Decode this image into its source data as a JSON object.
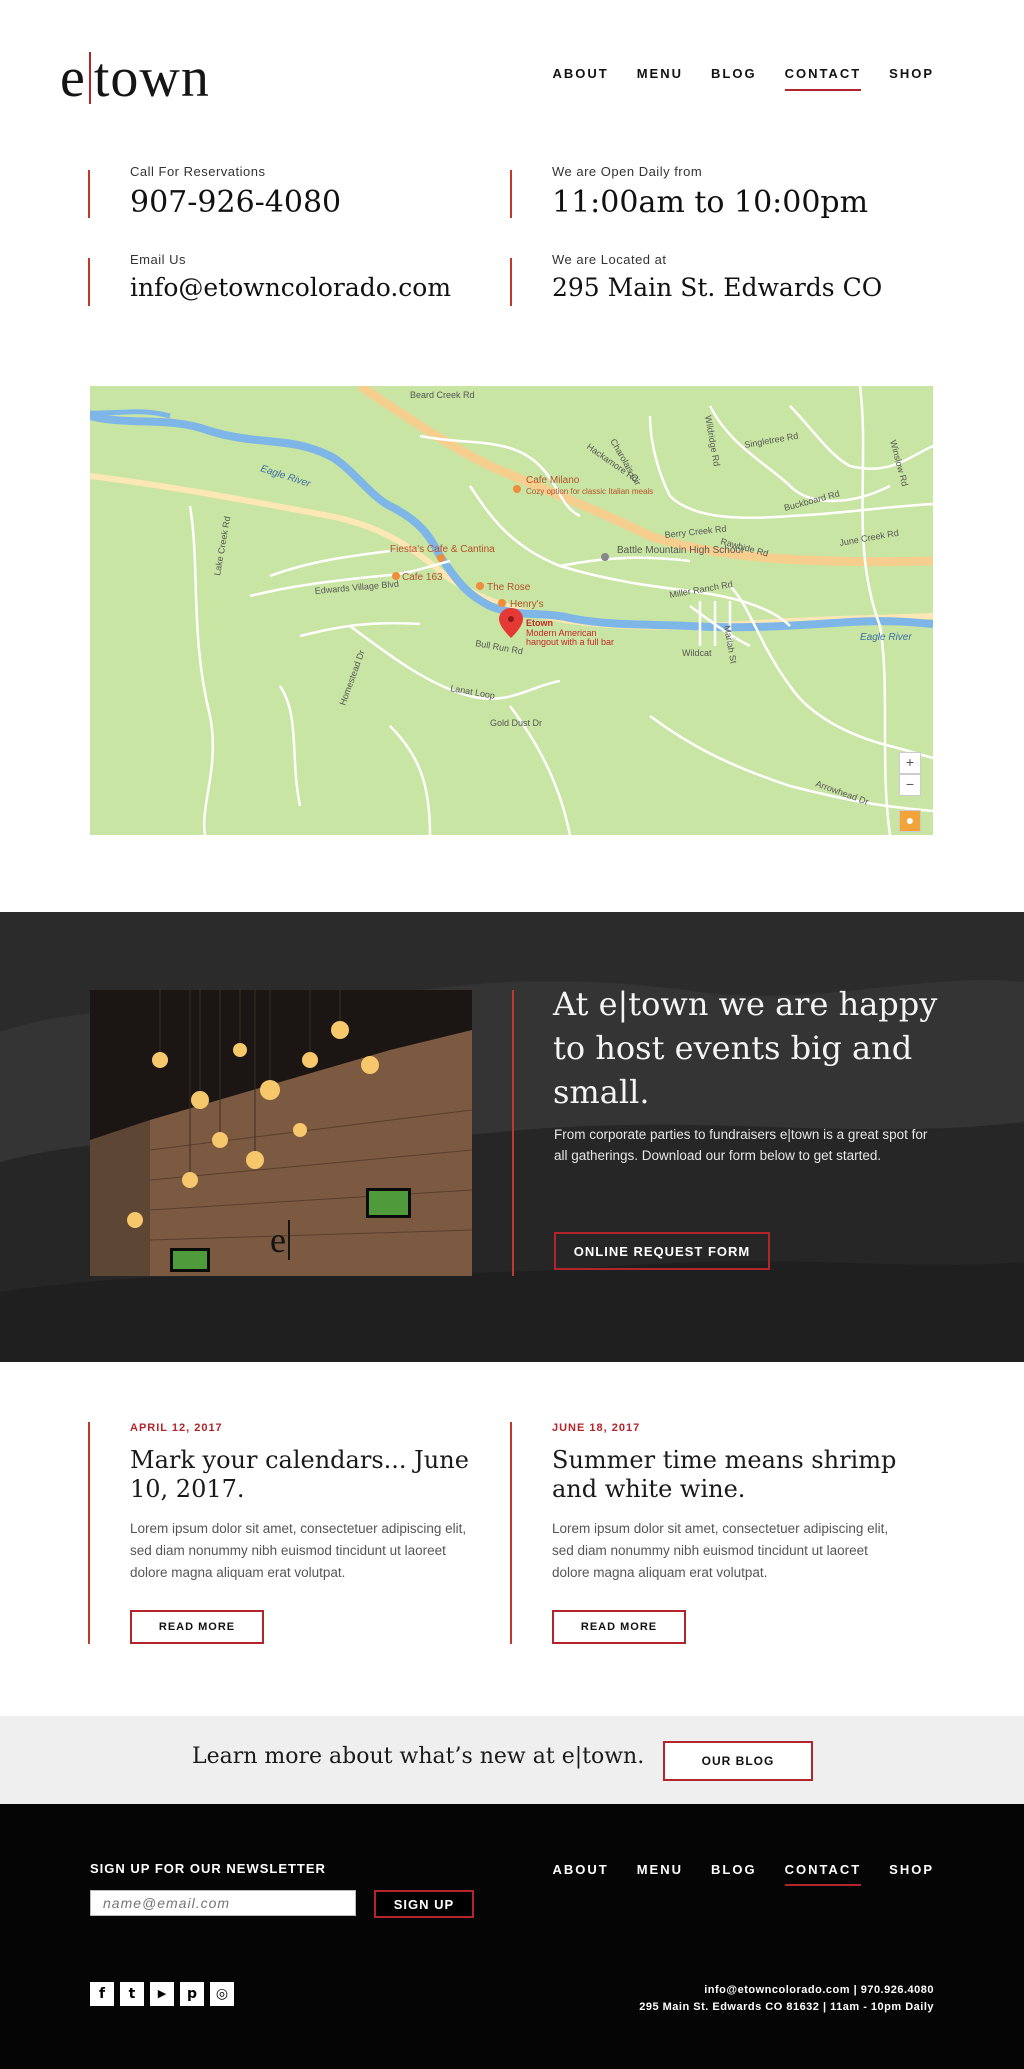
{
  "brand": {
    "logo_left": "e",
    "logo_right": "town"
  },
  "nav": {
    "items": [
      "ABOUT",
      "MENU",
      "BLOG",
      "CONTACT",
      "SHOP"
    ],
    "active": "CONTACT"
  },
  "contact": {
    "reservations_label": "Call For Reservations",
    "reservations_value": "907-926-4080",
    "hours_label": "We are Open Daily from",
    "hours_value": "11:00am to 10:00pm",
    "email_label": "Email Us",
    "email_value": "info@etowncolorado.com",
    "location_label": "We are Located at",
    "location_value": "295 Main St. Edwards CO"
  },
  "map": {
    "roads": [
      "Beard Creek Rd",
      "Hackamore Rd",
      "Charolais Cir",
      "Wildridge Rd",
      "Singletree Rd",
      "Winslow Rd",
      "Berry Creek Rd",
      "Rawhide Rd",
      "Buckboard Rd",
      "June Creek Rd",
      "Miller Ranch Rd",
      "Lake Creek Rd",
      "Edwards Village Blvd",
      "Homestead Dr",
      "Bull Run Rd",
      "Gold Dust Dr",
      "Lanat Loop",
      "Arrowhead Dr",
      "Wildcat",
      "Mariah St"
    ],
    "water": [
      "Eagle River"
    ],
    "places": [
      {
        "name": "Cafe Milano",
        "sub": "Cozy option for classic Italian meals"
      },
      {
        "name": "Fiesta's Cafe & Cantina",
        "sub": ""
      },
      {
        "name": "Cafe 163",
        "sub": ""
      },
      {
        "name": "The Rose",
        "sub": ""
      },
      {
        "name": "Henry's",
        "sub": ""
      },
      {
        "name": "Battle Mountain High School",
        "sub": ""
      }
    ],
    "marker": {
      "name": "Etown",
      "sub1": "Modern American",
      "sub2": "hangout with a full bar"
    },
    "zoom_in": "+",
    "zoom_out": "−"
  },
  "events": {
    "heading": "At e|town we are happy to host events big and small.",
    "body": "From corporate parties to fundraisers e|town is a great spot for all gatherings. Download our form below to get started.",
    "button": "ONLINE REQUEST FORM"
  },
  "news": [
    {
      "date": "APRIL 12, 2017",
      "title": "Mark your calendars... June 10, 2017.",
      "body": "Lorem ipsum dolor sit amet, consectetuer adipiscing elit, sed diam nonummy nibh euismod tincidunt ut laoreet dolore magna aliquam erat volutpat.",
      "button": "READ MORE"
    },
    {
      "date": "JUNE 18, 2017",
      "title": "Summer time means shrimp and white wine.",
      "body": "Lorem ipsum dolor sit amet, consectetuer adipiscing elit, sed diam nonummy nibh euismod tincidunt ut laoreet dolore magna aliquam erat volutpat.",
      "button": "READ MORE"
    }
  ],
  "blog_band": {
    "text": "Learn more about what’s new at e|town.",
    "button": "OUR BLOG"
  },
  "footer": {
    "newsletter_label": "SIGN UP FOR OUR NEWSLETTER",
    "email_placeholder": "name@email.com",
    "signup_button": "SIGN UP",
    "nav": [
      "ABOUT",
      "MENU",
      "BLOG",
      "CONTACT",
      "SHOP"
    ],
    "contact_line1": "info@etowncolorado.com  |  970.926.4080",
    "contact_line2": "295 Main St. Edwards CO 81632  |  11am - 10pm Daily",
    "social": [
      {
        "icon": "facebook-icon",
        "glyph": "f"
      },
      {
        "icon": "twitter-icon",
        "glyph": "t"
      },
      {
        "icon": "youtube-icon",
        "glyph": "▶"
      },
      {
        "icon": "pinterest-icon",
        "glyph": "p"
      },
      {
        "icon": "instagram-icon",
        "glyph": "◎"
      }
    ]
  },
  "colors": {
    "accent": "#b1252b",
    "footer_bg": "#050505",
    "map_land": "#c9e5a3",
    "map_water": "#7fb6e8",
    "map_highway": "#f6cf8f"
  }
}
